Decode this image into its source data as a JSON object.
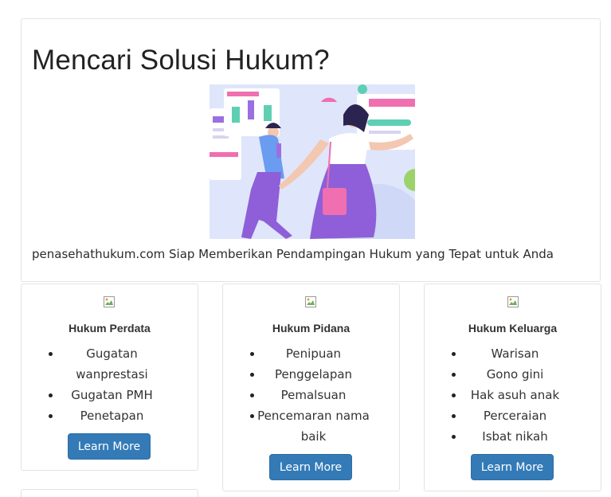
{
  "hero": {
    "title": "Mencari Solusi Hukum?",
    "tagline": "penasehathukum.com Siap Memberikan Pendampingan Hukum yang Tepat untuk Anda"
  },
  "cards": [
    {
      "title": "Hukum Perdata",
      "items": [
        "Gugatan wanprestasi",
        "Gugatan PMH",
        "Penetapan"
      ],
      "button": "Learn More"
    },
    {
      "title": "Hukum Pidana",
      "items": [
        "Penipuan",
        "Penggelapan",
        "Pemalsuan",
        "Pencemaran nama baik"
      ],
      "button": "Learn More"
    },
    {
      "title": "Hukum Keluarga",
      "items": [
        "Warisan",
        "Gono gini",
        "Hak asuh anak",
        "Perceraian",
        "Isbat nikah"
      ],
      "button": "Learn More"
    }
  ],
  "colors": {
    "button_bg": "#337ab7",
    "border": "#e3e3e3"
  }
}
